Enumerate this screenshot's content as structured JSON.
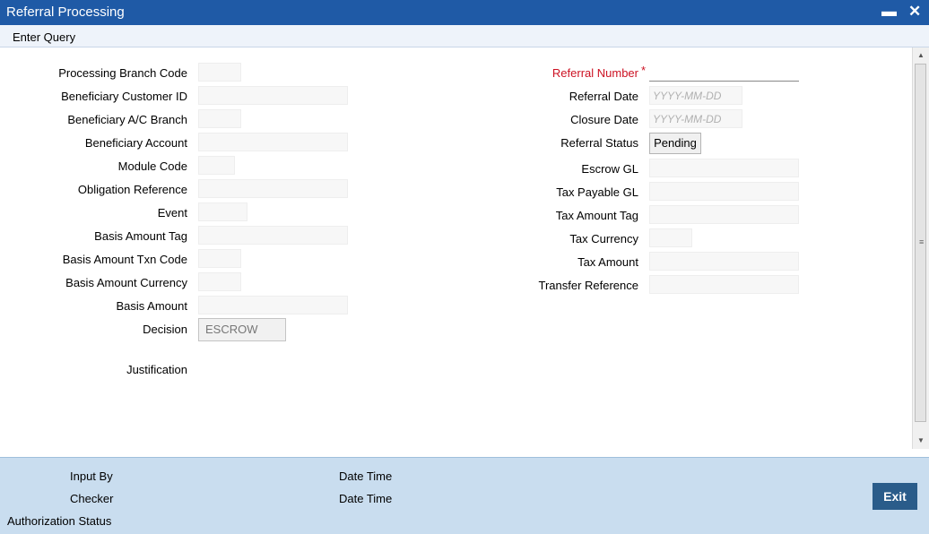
{
  "window": {
    "title": "Referral Processing",
    "minimize_glyph": "▬",
    "close_glyph": "✕"
  },
  "menu": {
    "enter_query": "Enter Query"
  },
  "left_labels": {
    "processing_branch_code": "Processing Branch Code",
    "beneficiary_customer_id": "Beneficiary Customer ID",
    "beneficiary_ac_branch": "Beneficiary A/C Branch",
    "beneficiary_account": "Beneficiary Account",
    "module_code": "Module Code",
    "obligation_reference": "Obligation Reference",
    "event": "Event",
    "basis_amount_tag": "Basis Amount Tag",
    "basis_amount_txn_code": "Basis Amount Txn Code",
    "basis_amount_currency": "Basis Amount Currency",
    "basis_amount": "Basis Amount",
    "decision": "Decision",
    "justification": "Justification"
  },
  "decision_value": "ESCROW",
  "right_labels": {
    "referral_number": "Referral Number",
    "required_mark": "*",
    "referral_date": "Referral Date",
    "closure_date": "Closure Date",
    "referral_status": "Referral Status",
    "escrow_gl": "Escrow GL",
    "tax_payable_gl": "Tax Payable GL",
    "tax_amount_tag": "Tax Amount Tag",
    "tax_currency": "Tax Currency",
    "tax_amount": "Tax Amount",
    "transfer_reference": "Transfer Reference"
  },
  "date_placeholder": "YYYY-MM-DD",
  "referral_status_value": "Pending",
  "footer": {
    "input_by": "Input By",
    "date_time_1": "Date Time",
    "checker": "Checker",
    "date_time_2": "Date Time",
    "authorization_status": "Authorization Status",
    "exit": "Exit"
  },
  "colors": {
    "titlebar": "#1f5aa6",
    "footer": "#c9ddef",
    "required": "#cc1122",
    "exit_button": "#2a5c8a"
  }
}
